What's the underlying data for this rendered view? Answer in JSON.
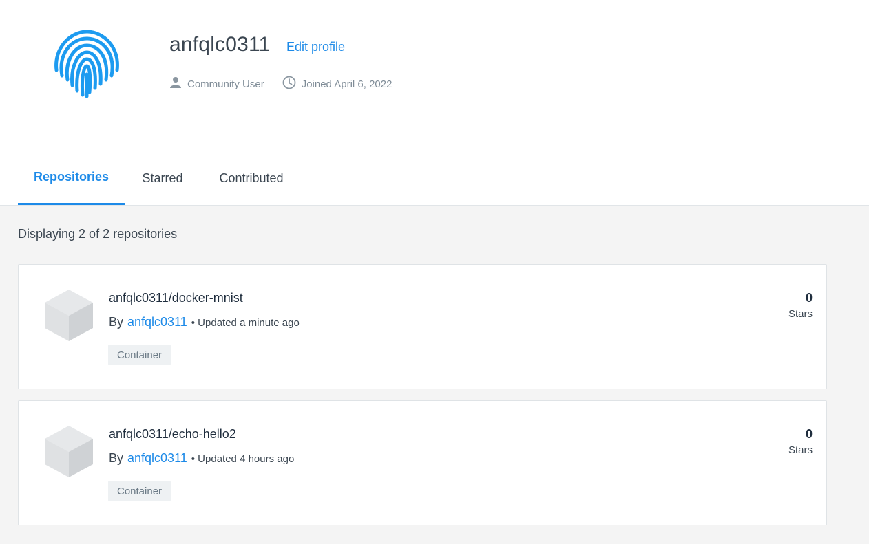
{
  "profile": {
    "username": "anfqlc0311",
    "edit_profile_label": "Edit profile",
    "role": "Community User",
    "joined": "Joined April 6, 2022",
    "avatar_icon": "fingerprint-icon",
    "avatar_color": "#1d9bf0"
  },
  "tabs": [
    {
      "label": "Repositories",
      "active": true
    },
    {
      "label": "Starred",
      "active": false
    },
    {
      "label": "Contributed",
      "active": false
    }
  ],
  "content": {
    "displaying_text": "Displaying 2 of 2 repositories"
  },
  "repositories": [
    {
      "name": "anfqlc0311/docker-mnist",
      "by_label": "By",
      "owner": "anfqlc0311",
      "updated": "• Updated a minute ago",
      "badge": "Container",
      "stars_count": "0",
      "stars_label": "Stars"
    },
    {
      "name": "anfqlc0311/echo-hello2",
      "by_label": "By",
      "owner": "anfqlc0311",
      "updated": "• Updated 4 hours ago",
      "badge": "Container",
      "stars_count": "0",
      "stars_label": "Stars"
    }
  ],
  "colors": {
    "accent": "#1d8ae8",
    "content_background": "#f4f4f4"
  }
}
